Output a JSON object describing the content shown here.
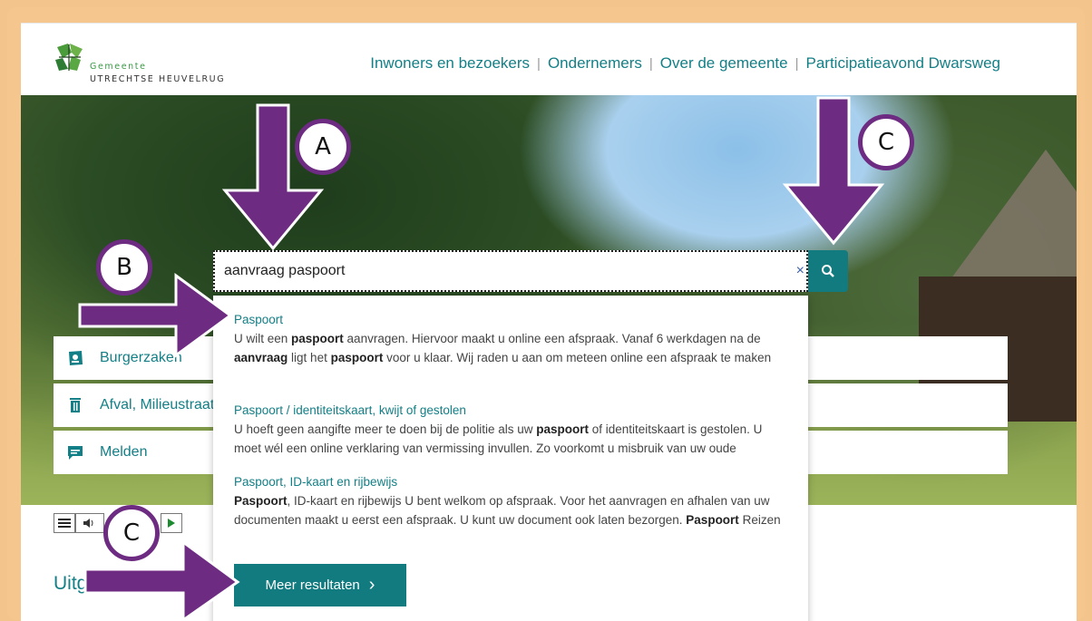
{
  "header": {
    "logo_line1": "Gemeente",
    "logo_line2": "UTRECHTSE HEUVELRUG",
    "nav": [
      "Inwoners en bezoekers",
      "Ondernemers",
      "Over de gemeente",
      "Participatieavond Dwarsweg"
    ],
    "nav_separator": "|"
  },
  "search": {
    "value": "aanvraag paspoort",
    "clear_icon": "×",
    "button_icon": "search-icon"
  },
  "quick_links": [
    {
      "label": "Burgerzaken",
      "icon": "id-card-icon"
    },
    {
      "label": "Afval, Milieustraat",
      "icon": "trash-icon"
    },
    {
      "label": "Melden",
      "icon": "chat-icon"
    }
  ],
  "results": [
    {
      "title": "Paspoort",
      "desc": [
        "U wilt een ",
        {
          "b": "paspoort"
        },
        " aanvragen. Hiervoor maakt u online een afspraak. Vanaf 6 werkdagen na de ",
        {
          "b": "aanvraag"
        },
        " ligt het ",
        {
          "b": "paspoort"
        },
        " voor u klaar. Wij raden u aan om meteen online een afspraak te maken"
      ]
    },
    {
      "title": "Paspoort / identiteitskaart, kwijt of gestolen",
      "desc": [
        "U hoeft geen aangifte meer te doen bij de politie als uw ",
        {
          "b": "paspoort"
        },
        " of identiteitskaart is gestolen. U moet wél een online verklaring van vermissing invullen. Zo voorkomt u misbruik van uw oude"
      ]
    },
    {
      "title": "Paspoort, ID-kaart en rijbewijs",
      "desc": [
        {
          "b": "Paspoort"
        },
        ", ID-kaart en rijbewijs U bent welkom op afspraak. Voor het aanvragen en afhalen van uw documenten maakt u eerst een afspraak. U kunt uw document ook laten bezorgen. ",
        {
          "b": "Paspoort"
        },
        " Reizen"
      ]
    }
  ],
  "more_button": {
    "label": "Meer resultaten",
    "chevron": "›"
  },
  "section_heading_partial": "Uitg",
  "annotations": [
    "A",
    "B",
    "C",
    "C"
  ],
  "colors": {
    "accent": "#117b7f",
    "link": "#137f86",
    "annotation": "#6d2b82",
    "frame": "#f5c78e"
  }
}
